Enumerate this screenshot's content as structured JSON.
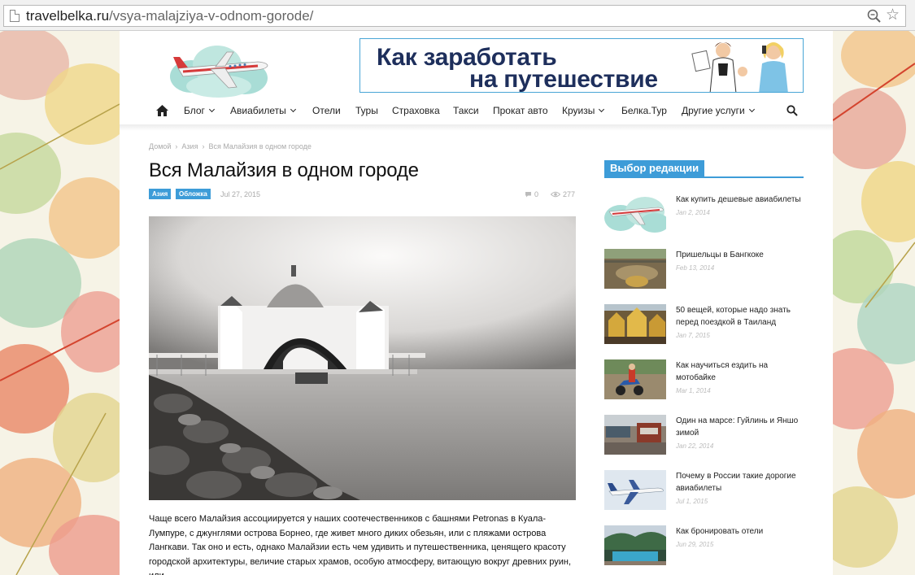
{
  "browser": {
    "url_host": "travelbelka.ru",
    "url_path": "/vsya-malajziya-v-odnom-gorode/"
  },
  "banner": {
    "line1": "Как заработать",
    "line2": "на путешествие"
  },
  "nav": {
    "items": [
      {
        "label": "Блог",
        "dropdown": true
      },
      {
        "label": "Авиабилеты",
        "dropdown": true
      },
      {
        "label": "Отели",
        "dropdown": false
      },
      {
        "label": "Туры",
        "dropdown": false
      },
      {
        "label": "Страховка",
        "dropdown": false
      },
      {
        "label": "Такси",
        "dropdown": false
      },
      {
        "label": "Прокат авто",
        "dropdown": false
      },
      {
        "label": "Круизы",
        "dropdown": true
      },
      {
        "label": "Белка.Тур",
        "dropdown": false
      },
      {
        "label": "Другие услуги",
        "dropdown": true
      }
    ]
  },
  "breadcrumb": [
    "Домой",
    "Азия",
    "Вся Малайзия в одном городе"
  ],
  "article": {
    "title": "Вся Малайзия в одном городе",
    "tags": [
      "Азия",
      "Обложка"
    ],
    "date": "Jul 27, 2015",
    "comments": "0",
    "views": "277",
    "body": "Чаще всего Малайзия ассоциируется у наших соотечественников с  башнями Petronas в Куала-Лумпуре, с джунглями острова Борнео, где живет много диких обезьян, или с пляжами острова Лангкави. Так оно и есть, однако Малайзии есть чем удивить и путешественника, ценящего красоту городской архитектуры, величие старых храмов, особую атмосферу, витающую вокруг древних руин, или"
  },
  "sidebar": {
    "heading": "Выбор редакции",
    "items": [
      {
        "title": "Как купить дешевые авиабилеты",
        "date": "Jan 2, 2014"
      },
      {
        "title": "Пришельцы в Бангкоке",
        "date": "Feb 13, 2014"
      },
      {
        "title": "50 вещей, которые надо знать перед поездкой в Таиланд",
        "date": "Jan 7, 2015"
      },
      {
        "title": "Как научиться ездить на мотобайке",
        "date": "Mar 1, 2014"
      },
      {
        "title": "Один на марсе: Гуйлинь и Яншо зимой",
        "date": "Jan 22, 2014"
      },
      {
        "title": "Почему в России такие дорогие авиабилеты",
        "date": "Jul 1, 2015"
      },
      {
        "title": "Как бронировать отели",
        "date": "Jun 29, 2015"
      }
    ]
  },
  "colors": {
    "accent": "#3d9cd8",
    "banner_text": "#1e2f5c",
    "wallpaper": "#f6f3e6"
  },
  "icons": [
    "page-icon",
    "zoom-icon",
    "star-icon",
    "home-icon",
    "search-icon",
    "comment-icon",
    "eye-icon"
  ]
}
